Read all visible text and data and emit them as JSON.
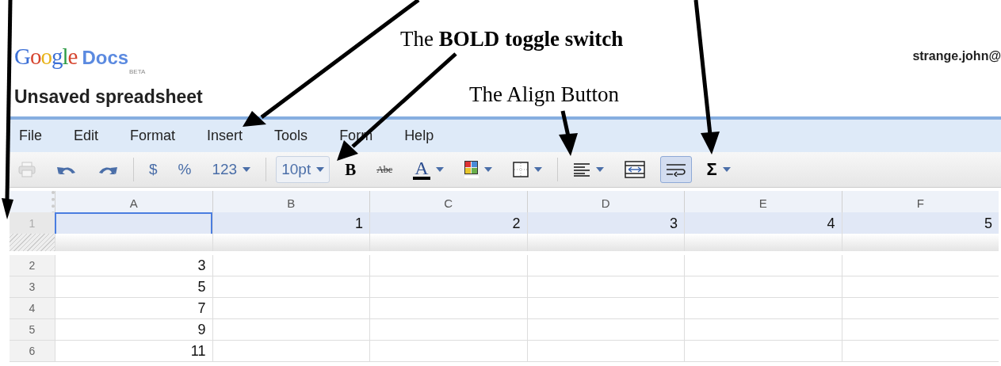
{
  "header": {
    "logo": {
      "name": "Google",
      "product": "Docs",
      "badge": "BETA"
    },
    "title": "Unsaved spreadsheet",
    "user": "strange.john@"
  },
  "menu": [
    "File",
    "Edit",
    "Format",
    "Insert",
    "Tools",
    "Form",
    "Help"
  ],
  "toolbar": [
    {
      "kind": "print",
      "disabled": true,
      "pressed": false
    },
    {
      "kind": "undo",
      "disabled": false,
      "pressed": false
    },
    {
      "kind": "redo",
      "disabled": false,
      "pressed": false
    },
    {
      "kind": "separator"
    },
    {
      "kind": "text",
      "label": "$",
      "disabled": false,
      "pressed": false
    },
    {
      "kind": "text",
      "label": "%",
      "disabled": false,
      "pressed": false
    },
    {
      "kind": "text",
      "label": "123",
      "dropdown": true,
      "disabled": false,
      "pressed": false
    },
    {
      "kind": "separator"
    },
    {
      "kind": "fontsize",
      "label": "10pt",
      "dropdown": true,
      "disabled": false,
      "pressed": false
    },
    {
      "kind": "bold",
      "label": "B",
      "disabled": false,
      "pressed": false
    },
    {
      "kind": "strike",
      "label": "Abc",
      "disabled": false,
      "pressed": false
    },
    {
      "kind": "textcolor",
      "label": "A",
      "dropdown": true,
      "disabled": false,
      "pressed": false
    },
    {
      "kind": "fill",
      "dropdown": true,
      "disabled": false,
      "pressed": false
    },
    {
      "kind": "borders",
      "dropdown": true,
      "disabled": false,
      "pressed": false
    },
    {
      "kind": "separator"
    },
    {
      "kind": "align",
      "dropdown": true,
      "disabled": false,
      "pressed": false
    },
    {
      "kind": "merge",
      "disabled": false,
      "pressed": false
    },
    {
      "kind": "wrap",
      "disabled": false,
      "pressed": true
    },
    {
      "kind": "sum",
      "label": "Σ",
      "dropdown": true,
      "disabled": false,
      "pressed": false
    }
  ],
  "columns": [
    "A",
    "B",
    "C",
    "D",
    "E",
    "F"
  ],
  "rows": [
    {
      "header": "1",
      "selected": true,
      "frozen": true,
      "cells": [
        {
          "selected": true
        },
        {
          "value": "1",
          "selected": false
        },
        {
          "value": "2",
          "selected": false
        },
        {
          "value": "3",
          "selected": false
        },
        {
          "value": "4",
          "selected": false
        },
        {
          "value": "5",
          "selected": false
        }
      ]
    },
    {
      "header": "2",
      "selected": false,
      "frozen": false,
      "cells": [
        {
          "value": "3",
          "selected": false
        },
        {
          "selected": false
        },
        {
          "selected": false
        },
        {
          "selected": false
        },
        {
          "selected": false
        },
        {
          "selected": false
        }
      ]
    },
    {
      "header": "3",
      "selected": false,
      "frozen": false,
      "cells": [
        {
          "value": "5",
          "selected": false
        },
        {
          "selected": false
        },
        {
          "selected": false
        },
        {
          "selected": false
        },
        {
          "selected": false
        },
        {
          "selected": false
        }
      ]
    },
    {
      "header": "4",
      "selected": false,
      "frozen": false,
      "cells": [
        {
          "value": "7",
          "selected": false
        },
        {
          "selected": false
        },
        {
          "selected": false
        },
        {
          "selected": false
        },
        {
          "selected": false
        },
        {
          "selected": false
        }
      ]
    },
    {
      "header": "5",
      "selected": false,
      "frozen": false,
      "cells": [
        {
          "value": "9",
          "selected": false
        },
        {
          "selected": false
        },
        {
          "selected": false
        },
        {
          "selected": false
        },
        {
          "selected": false
        },
        {
          "selected": false
        }
      ]
    },
    {
      "header": "6",
      "selected": false,
      "frozen": false,
      "cells": [
        {
          "value": "11",
          "selected": false
        },
        {
          "selected": false
        },
        {
          "selected": false
        },
        {
          "selected": false
        },
        {
          "selected": false
        },
        {
          "selected": false
        }
      ]
    }
  ],
  "annotations": [
    {
      "text": "The **BOLD toggle switch**"
    },
    {
      "text": "The Align Button"
    }
  ]
}
